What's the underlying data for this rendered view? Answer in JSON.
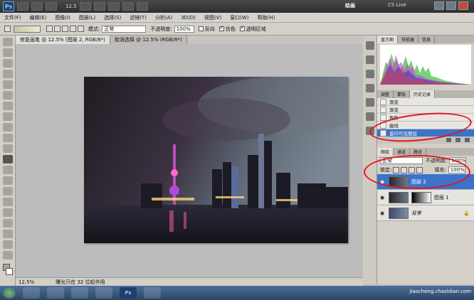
{
  "app": {
    "logo": "Ps",
    "zoom": "12.5",
    "workspace": "绘画",
    "cslive": "CS Live"
  },
  "menu": [
    "文件(F)",
    "编辑(E)",
    "图像(I)",
    "图层(L)",
    "选择(S)",
    "滤镜(T)",
    "分析(A)",
    "3D(D)",
    "视图(V)",
    "窗口(W)",
    "帮助(H)"
  ],
  "options": {
    "mode_label": "模式:",
    "mode_value": "正常",
    "opacity_label": "不透明度:",
    "opacity_value": "100%",
    "reverse": "反向",
    "dither": "仿色",
    "transparency": "透明区域"
  },
  "doc_tabs": [
    "修复画笔 @ 12.5% (图层 2, RGB/8*)",
    "取消选择 @ 12.5% (RGB/8*)"
  ],
  "status": {
    "zoom": "12.5%",
    "info": "曝光只在 32 位起作用"
  },
  "panels": {
    "top_tabs": [
      "直方图",
      "导航器",
      "信息"
    ],
    "mid_tabs": [
      "调整",
      "蒙版",
      "历史记录"
    ],
    "history": [
      {
        "label": "渐变",
        "selected": false
      },
      {
        "label": "渐变",
        "selected": false
      },
      {
        "label": "色阶",
        "selected": false
      },
      {
        "label": "曲线",
        "selected": false
      },
      {
        "label": "盖印可见图层",
        "selected": true
      }
    ],
    "layer_tabs": [
      "图层",
      "通道",
      "路径"
    ],
    "blend": "正常",
    "opacity_label": "不透明度:",
    "opacity": "100%",
    "lock_label": "锁定:",
    "fill_label": "填充:",
    "fill": "100%",
    "layers": [
      {
        "name": "图层 2",
        "selected": true,
        "mask": false
      },
      {
        "name": "图层 1",
        "selected": false,
        "mask": true
      },
      {
        "name": "背景",
        "selected": false,
        "mask": false
      }
    ]
  },
  "taskbar": [
    "Ps"
  ],
  "watermark": "jiaocheng.chazidian.com",
  "colors": {
    "highlight": "#3b73c9",
    "ellipse": "#e3141b"
  }
}
